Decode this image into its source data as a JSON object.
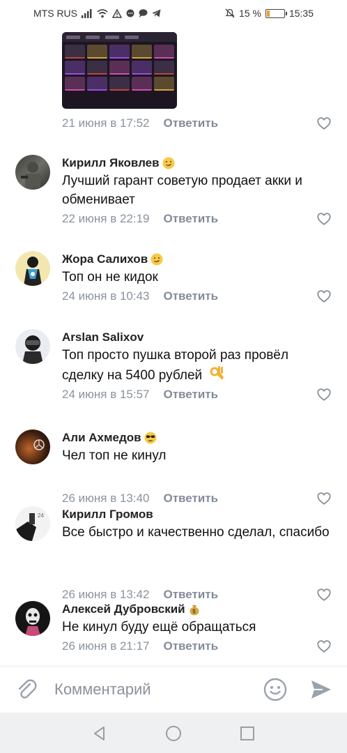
{
  "status_bar": {
    "carrier": "MTS RUS",
    "battery_percent": "15 %",
    "battery_level": 0.15,
    "time": "15:35",
    "icons": [
      "signal-icon",
      "wifi-icon",
      "warning-icon",
      "sms-icon",
      "message-icon",
      "telegram-icon",
      "mute-icon",
      "battery-icon"
    ]
  },
  "colors": {
    "accent": "#818c99",
    "meta_text": "#8a929b",
    "divider": "#e7e8ec",
    "nav_background": "#eff0f2"
  },
  "top_post": {
    "date": "21 июня в 17:52",
    "reply_label": "Ответить"
  },
  "comments": [
    {
      "author": "Кирилл Яковлев",
      "emoji": "emoji-smirk",
      "text": "Лучший гарант советую продает акки и обменивает",
      "date": "22 июня в 22:19",
      "reply_label": "Ответить"
    },
    {
      "author": "Жора Салихов",
      "emoji": "emoji-smirk",
      "text": "Топ он не кидок",
      "date": "24 июня в 10:43",
      "reply_label": "Ответить"
    },
    {
      "author": "Arslan Salixov",
      "emoji": "",
      "text": "Топ просто пушка второй раз провёл сделку на 5400 рублей",
      "date": "24 июня в 15:57",
      "reply_label": "Ответить"
    },
    {
      "author": "Али Ахмедов",
      "emoji": "emoji-sunglasses",
      "text": "Чел топ не кинул",
      "date": "26 июня в 13:40",
      "reply_label": "Ответить"
    },
    {
      "author": "Кирилл Громов",
      "emoji": "",
      "text": "Все быстро и качественно сделал, спасибо",
      "date": "26 июня в 13:42",
      "reply_label": "Ответить"
    },
    {
      "author": "Алексей Дубровский",
      "emoji": "emoji-money-bag",
      "text": "Не кинул буду ещё обращаться",
      "date": "26 июня в 21:17",
      "reply_label": "Ответить"
    }
  ],
  "composer": {
    "placeholder": "Комментарий",
    "value": "",
    "icons": [
      "attach-icon",
      "emoji-icon",
      "send-icon"
    ]
  },
  "nav": {
    "icons": [
      "back-icon",
      "home-icon",
      "recents-icon"
    ]
  }
}
